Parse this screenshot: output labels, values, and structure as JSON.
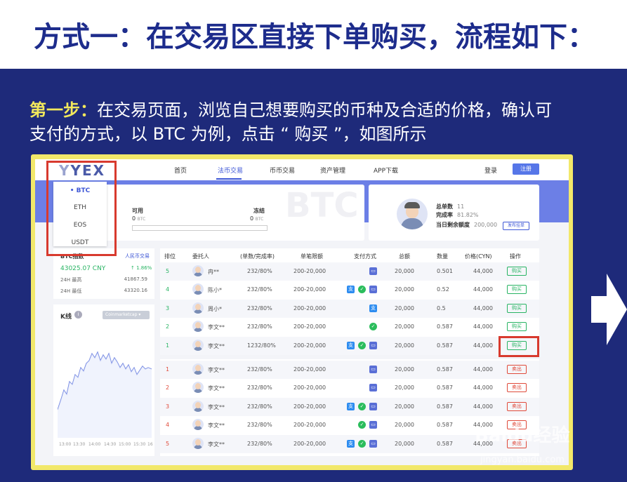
{
  "banner": {
    "title": "方式一：在交易区直接下单购买，流程如下："
  },
  "step": {
    "label": "第一步：",
    "text": "在交易页面，浏览自己想要购买的币种及合适的价格，确认可支付的方式，以 BTC 为例，点击 “ 购买 ”，如图所示"
  },
  "nav": {
    "logo": "YEX",
    "items": [
      "首页",
      "法币交易",
      "币币交易",
      "资产管理",
      "APP下载"
    ],
    "login": "登录",
    "register": "注册"
  },
  "coins": [
    "• BTC",
    "ETH",
    "EOS",
    "USDT"
  ],
  "balance": {
    "available_label": "可用",
    "available_value": "0",
    "frozen_label": "冻结",
    "frozen_value": "0",
    "unit": "BTC",
    "watermark": "BTC"
  },
  "profile": {
    "orders_label": "总单数",
    "orders_value": "11",
    "rate_label": "完成率",
    "rate_value": "81.82%",
    "limit_label": "当日剩余额度",
    "limit_value": "200,000",
    "publish": "发布挂单"
  },
  "index": {
    "title": "BTC指数",
    "link": "人民币交易",
    "price": "43025.07 CNY",
    "change": "↑ 1.86%",
    "high_label": "24H 最高",
    "high_value": "41867.59",
    "low_label": "24H 最低",
    "low_value": "43320.16"
  },
  "kline": {
    "title": "K线",
    "source": "Coinmarketcap ▾",
    "ticks": [
      "13:00",
      "13:30",
      "14:00",
      "14:30",
      "15:00",
      "15:30",
      "16"
    ]
  },
  "table": {
    "headers": [
      "排位",
      "委托人",
      "(单数/完成率)",
      "单笔限额",
      "支付方式",
      "总额",
      "数量",
      "价格(CYN)",
      "操作"
    ],
    "buy_rows": [
      {
        "rank": "5",
        "user": "冉**",
        "stats": "232/80%",
        "limit": "200-20,000",
        "pay": [
          "bank"
        ],
        "total": "20,000",
        "qty": "0.501",
        "price": "44,000",
        "action": "购买"
      },
      {
        "rank": "4",
        "user": "陈小*",
        "stats": "232/80%",
        "limit": "200-20,000",
        "pay": [
          "alipay",
          "wechat",
          "bank"
        ],
        "total": "20,000",
        "qty": "0.52",
        "price": "44,000",
        "action": "购买"
      },
      {
        "rank": "3",
        "user": "周小*",
        "stats": "232/80%",
        "limit": "200-20,000",
        "pay": [
          "alipay"
        ],
        "total": "20,000",
        "qty": "0.5",
        "price": "44,000",
        "action": "购买"
      },
      {
        "rank": "2",
        "user": "李文**",
        "stats": "232/80%",
        "limit": "200-20,000",
        "pay": [
          "wechat"
        ],
        "total": "20,000",
        "qty": "0.587",
        "price": "44,000",
        "action": "购买"
      },
      {
        "rank": "1",
        "user": "李文**",
        "stats": "1232/80%",
        "limit": "200-20,000",
        "pay": [
          "alipay",
          "wechat",
          "bank"
        ],
        "total": "20,000",
        "qty": "0.587",
        "price": "44,000",
        "action": "购买"
      }
    ],
    "sell_rows": [
      {
        "rank": "1",
        "user": "李文**",
        "stats": "232/80%",
        "limit": "200-20,000",
        "pay": [
          "bank"
        ],
        "total": "20,000",
        "qty": "0.587",
        "price": "44,000",
        "action": "卖出"
      },
      {
        "rank": "2",
        "user": "李文**",
        "stats": "232/80%",
        "limit": "200-20,000",
        "pay": [
          "bank"
        ],
        "total": "20,000",
        "qty": "0.587",
        "price": "44,000",
        "action": "卖出"
      },
      {
        "rank": "3",
        "user": "李文**",
        "stats": "232/80%",
        "limit": "200-20,000",
        "pay": [
          "alipay",
          "wechat",
          "bank"
        ],
        "total": "20,000",
        "qty": "0.587",
        "price": "44,000",
        "action": "卖出"
      },
      {
        "rank": "4",
        "user": "李文**",
        "stats": "232/80%",
        "limit": "200-20,000",
        "pay": [
          "wechat",
          "bank"
        ],
        "total": "20,000",
        "qty": "0.587",
        "price": "44,000",
        "action": "卖出"
      },
      {
        "rank": "5",
        "user": "李文**",
        "stats": "232/80%",
        "limit": "200-20,000",
        "pay": [
          "alipay",
          "wechat",
          "bank"
        ],
        "total": "20,000",
        "qty": "0.587",
        "price": "44,000",
        "action": "卖出"
      }
    ]
  },
  "watermark": {
    "brand": "Baidu经验",
    "url": "jingyan.baidu.com"
  },
  "colors": {
    "navy": "#1e2a7a",
    "highlight": "#d83a2e",
    "buy": "#28b463",
    "sell": "#e04a3a",
    "accent": "#3d56d6",
    "step": "#f2e85c"
  }
}
